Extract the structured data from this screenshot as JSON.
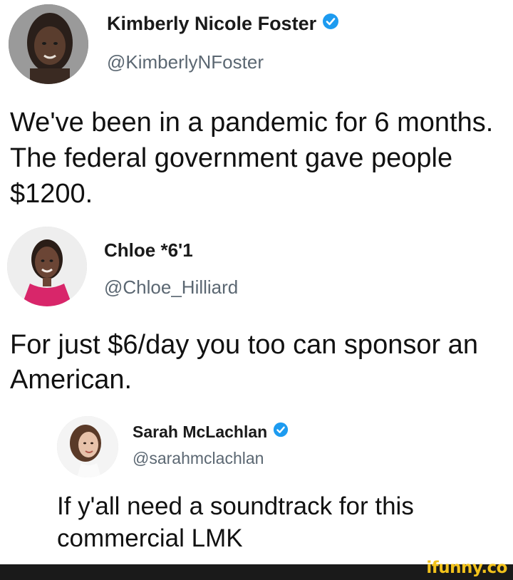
{
  "tweets": [
    {
      "name": "Kimberly Nicole Foster",
      "handle": "@KimberlyNFoster",
      "verified": true,
      "text": "We've been in a pandemic for 6 months. The federal government gave people $1200."
    },
    {
      "name": "Chloe *6'1",
      "handle": "@Chloe_Hilliard",
      "verified": false,
      "text": "For just $6/day you too can sponsor an American."
    },
    {
      "name": "Sarah McLachlan",
      "handle": "@sarahmclachlan",
      "verified": true,
      "text": "If y'all need a soundtrack for this commercial LMK"
    }
  ],
  "watermark": "ifunny.co",
  "colors": {
    "verified_badge": "#1d9bf0",
    "handle": "#5b6772",
    "watermark": "#f2c21b"
  },
  "icons": [
    "avatar",
    "verified-badge-icon"
  ]
}
